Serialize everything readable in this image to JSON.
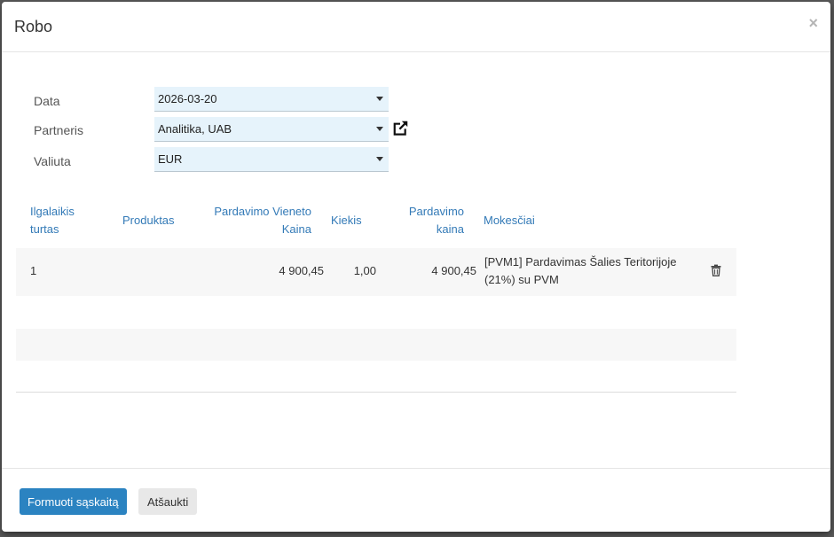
{
  "dialog": {
    "title": "Robo",
    "close_label": "×"
  },
  "form": {
    "date": {
      "label": "Data",
      "value": "2026-03-20"
    },
    "partner": {
      "label": "Partneris",
      "value": "Analitika, UAB"
    },
    "currency": {
      "label": "Valiuta",
      "value": "EUR"
    }
  },
  "table": {
    "headers": {
      "asset_1": "Ilgalaikis",
      "asset_2": "turtas",
      "product": "Produktas",
      "unit_price_1": "Pardavimo Vieneto",
      "unit_price_2": "Kaina",
      "qty": "Kiekis",
      "price_1": "Pardavimo",
      "price_2": "kaina",
      "taxes": "Mokesčiai"
    },
    "rows": [
      {
        "asset": "1",
        "product": "",
        "unit_price": "4 900,45",
        "qty": "1,00",
        "price": "4 900,45",
        "tax_1": "[PVM1] Pardavimas Šalies Teritorijoje",
        "tax_2": "(21%) su PVM"
      }
    ]
  },
  "footer": {
    "primary_label": "Formuoti sąskaitą",
    "cancel_label": "Atšaukti"
  },
  "icons": {
    "external_link": "external-link-icon",
    "trash": "trash-icon",
    "caret": "caret-down-icon"
  },
  "colors": {
    "primary": "#2b83c1",
    "link": "#337ab7",
    "field_bg": "#e6f3fb"
  }
}
